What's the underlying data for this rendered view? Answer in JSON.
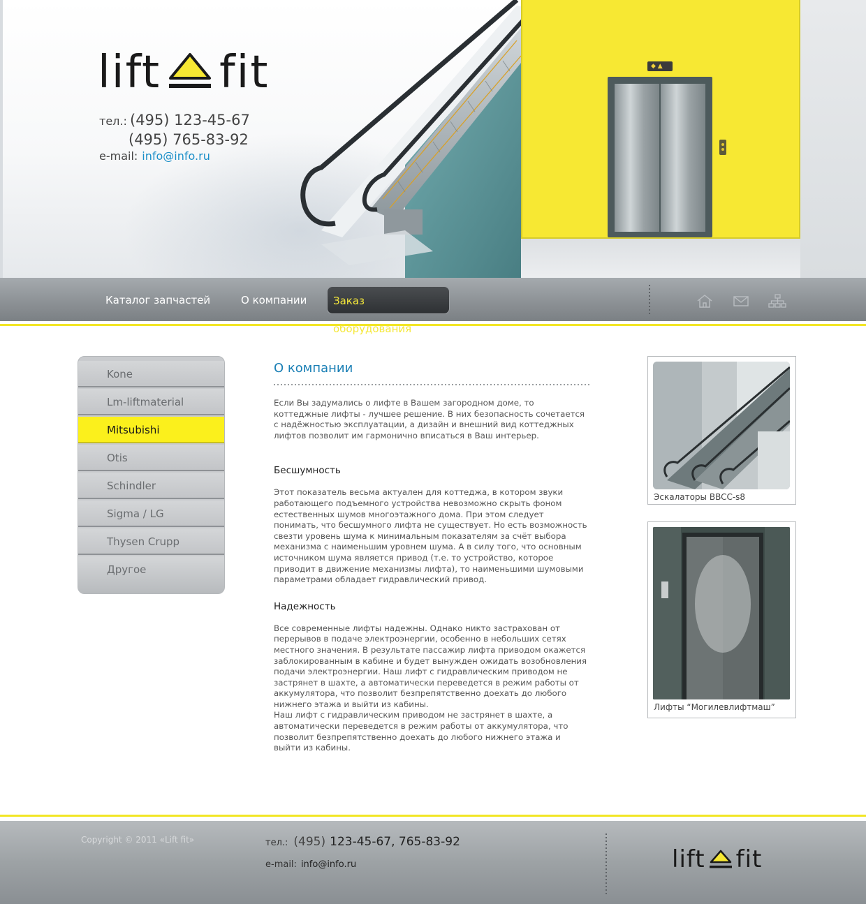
{
  "header": {
    "logo": {
      "left_word": "lift",
      "right_word": "fit"
    },
    "contact": {
      "tel_label": "тел.:",
      "phone_1": "(495) 123-45-67",
      "phone_2": "(495) 765-83-92",
      "email_label": "e-mail:",
      "email": "info@info.ru"
    }
  },
  "nav": {
    "items": [
      {
        "label": "Каталог запчастей",
        "active": false
      },
      {
        "label": "О компании",
        "active": false
      },
      {
        "label": "Заказ оборудования",
        "active": true
      }
    ],
    "icons": [
      "home-icon",
      "mail-icon",
      "sitemap-icon"
    ]
  },
  "sidebar": {
    "items": [
      {
        "label": "Kone",
        "active": false
      },
      {
        "label": "Lm-liftmaterial",
        "active": false
      },
      {
        "label": "Mitsubishi",
        "active": true
      },
      {
        "label": "Otis",
        "active": false
      },
      {
        "label": "Schindler",
        "active": false
      },
      {
        "label": "Sigma / LG",
        "active": false
      },
      {
        "label": "Thysen Crupp",
        "active": false
      },
      {
        "label": "Другое",
        "active": false
      }
    ]
  },
  "main": {
    "title": "О компании",
    "intro": "Если Вы задумались о лифте в Вашем загородном доме, то коттеджные лифты - лучшее решение. В них безопасность сочетается с надёжностью эксплуатации, а дизайн и внешний вид коттеджных лифтов позволит им гармонично вписаться в Ваш интерьер.",
    "section_1_heading": "Бесшумность",
    "section_1_text": "Этот показатель весьма актуален для коттеджа, в котором звуки работающего подъемного устройства невозможно скрыть фоном естественных шумов многоэтажного дома. При этом следует понимать, что бесшумного лифта не существует. Но есть возможность свезти уровень шума к минимальным показателям за счёт выбора механизма с наименьшим уровнем шума. А в силу того, что основным источником шума является привод (т.е. то устройство, которое приводит в движение механизмы лифта), то наименьшими шумовыми параметрами обладает гидравлический привод.",
    "section_2_heading": "Надежность",
    "section_2_text_a": "Все современные лифты надежны. Однако никто застрахован от перерывов в подаче электроэнергии, особенно в небольших сетях местного значения. В результате пассажир лифта приводом окажется заблокированным в кабине и будет вынужден ожидать возобновления подачи электроэнергии. Наш лифт с гидравлическим приводом не застрянет в шахте, а автоматически переведется в режим работы от аккумулятора, что позволит безпрепятственно доехать до любого нижнего этажа и выйти из кабины.",
    "section_2_text_b": "Наш лифт с гидравлическим приводом не застрянет в шахте, а автоматически переведется в режим работы от аккумулятора, что позволит безпрепятственно доехать до любого нижнего этажа и выйти из кабины."
  },
  "photos": [
    {
      "caption": "Эскалаторы BBCC-s8"
    },
    {
      "caption": "Лифты “Могилевлифтмаш”"
    }
  ],
  "footer": {
    "copyright": "Copyright © 2011 «Lift fit»",
    "tel_label": "тел.:",
    "tel_code": "(495)",
    "tel_numbers": "123-45-67, 765-83-92",
    "email_label": "e-mail:",
    "email": "info@info.ru",
    "logo": {
      "left_word": "lift",
      "right_word": "fit"
    }
  },
  "colors": {
    "accent_yellow": "#f7e833",
    "link_blue": "#1a7fb5",
    "nav_gray": "#8d9296"
  }
}
